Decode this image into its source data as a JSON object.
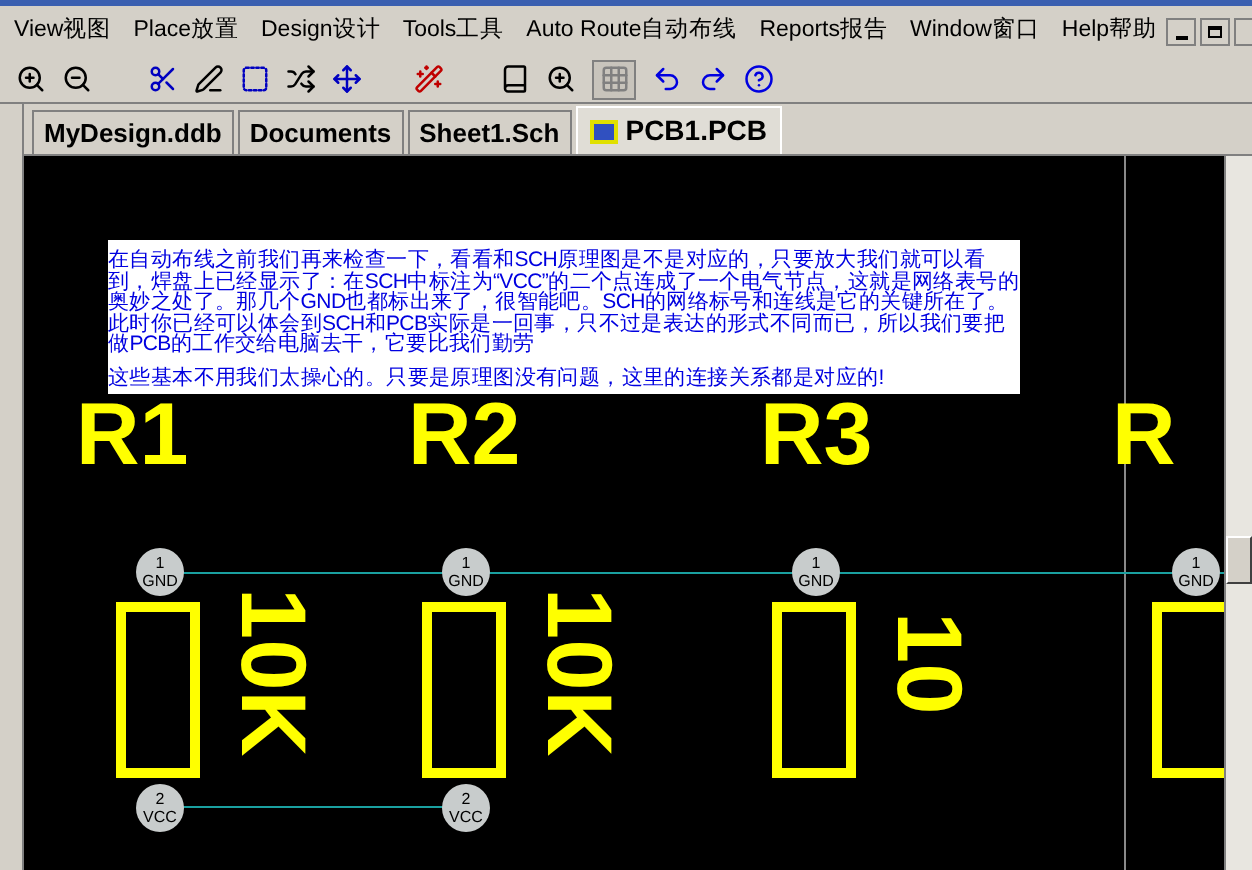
{
  "menu": [
    "View视图",
    "Place放置",
    "Design设计",
    "Tools工具",
    "Auto Route自动布线",
    "Reports报告",
    "Window窗口",
    "Help帮助"
  ],
  "tabs": [
    {
      "label": "MyDesign.ddb",
      "selected": false
    },
    {
      "label": "Documents",
      "selected": false
    },
    {
      "label": "Sheet1.Sch",
      "selected": false
    },
    {
      "label": "PCB1.PCB",
      "selected": true
    }
  ],
  "note": {
    "paragraphs": [
      "在自动布线之前我们再来检查一下，看看和SCH原理图是不是对应的，只要放大我们就可以看到，焊盘上已经显示了：在SCH中标注为“VCC”的二个点连成了一个电气节点，这就是网络表号的奥妙之处了。那几个GND也都标出来了，很智能吧。SCH的网络标号和连线是它的关键所在了。此时你已经可以体会到SCH和PCB实际是一回事，只不过是表达的形式不同而已，所以我们要把做PCB的工作交给电脑去干，它要比我们勤劳",
      "这些基本不用我们太操心的。只要是原理图没有问题，这里的连接关系都是对应的!"
    ]
  },
  "components": [
    {
      "designator": "R1",
      "value": "10K",
      "pads": [
        {
          "number": "1",
          "net": "GND"
        },
        {
          "number": "2",
          "net": "VCC"
        }
      ]
    },
    {
      "designator": "R2",
      "value": "10K",
      "pads": [
        {
          "number": "1",
          "net": "GND"
        },
        {
          "number": "2",
          "net": "VCC"
        }
      ]
    },
    {
      "designator": "R3",
      "value": "10",
      "pads": [
        {
          "number": "1",
          "net": "GND"
        }
      ]
    },
    {
      "designator": "R",
      "pads": [
        {
          "number": "1",
          "net": "GND"
        }
      ]
    }
  ]
}
